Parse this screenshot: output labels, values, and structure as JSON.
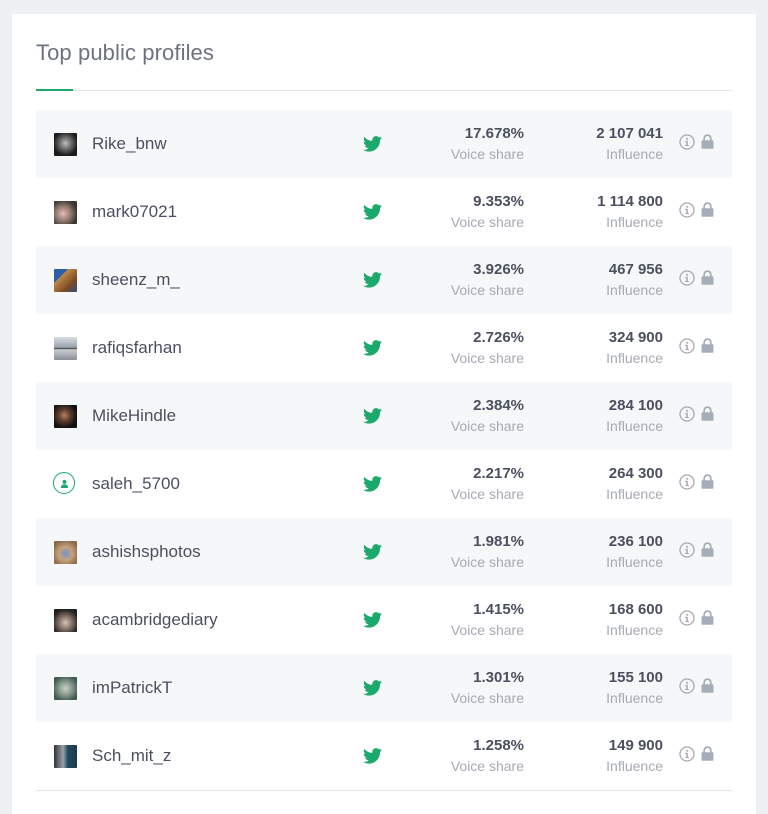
{
  "widget": {
    "title": "Top public profiles",
    "accent_color": "#1aa86b"
  },
  "labels": {
    "voice_share": "Voice share",
    "influence": "Influence"
  },
  "profiles": [
    {
      "name": "Rike_bnw",
      "network": "twitter-icon",
      "voice_share": "17.678%",
      "influence": "2 107 041",
      "avatar": "photo"
    },
    {
      "name": "mark07021",
      "network": "twitter-icon",
      "voice_share": "9.353%",
      "influence": "1 114 800",
      "avatar": "photo"
    },
    {
      "name": "sheenz_m_",
      "network": "twitter-icon",
      "voice_share": "3.926%",
      "influence": "467 956",
      "avatar": "photo"
    },
    {
      "name": "rafiqsfarhan",
      "network": "twitter-icon",
      "voice_share": "2.726%",
      "influence": "324 900",
      "avatar": "photo"
    },
    {
      "name": "MikeHindle",
      "network": "twitter-icon",
      "voice_share": "2.384%",
      "influence": "284 100",
      "avatar": "photo"
    },
    {
      "name": "saleh_5700",
      "network": "twitter-icon",
      "voice_share": "2.217%",
      "influence": "264 300",
      "avatar": "default-user-icon"
    },
    {
      "name": "ashishsphotos",
      "network": "twitter-icon",
      "voice_share": "1.981%",
      "influence": "236 100",
      "avatar": "photo"
    },
    {
      "name": "acambridgediary",
      "network": "twitter-icon",
      "voice_share": "1.415%",
      "influence": "168 600",
      "avatar": "photo"
    },
    {
      "name": "imPatrickT",
      "network": "twitter-icon",
      "voice_share": "1.301%",
      "influence": "155 100",
      "avatar": "photo"
    },
    {
      "name": "Sch_mit_z",
      "network": "twitter-icon",
      "voice_share": "1.258%",
      "influence": "149 900",
      "avatar": "photo"
    }
  ]
}
